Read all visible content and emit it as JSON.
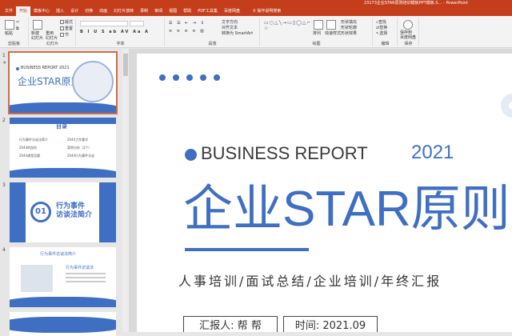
{
  "window": {
    "title": "23173企业STAR原则培训模板PPT模板.S… - PowerPoint"
  },
  "tabs": [
    "文件",
    "开始",
    "模板中心",
    "插入",
    "设计",
    "切换",
    "动画",
    "幻灯片放映",
    "录制",
    "审阅",
    "视图",
    "帮助",
    "PDF工具集",
    "百度网盘"
  ],
  "active_tab": "开始",
  "help_tab": "操作说明搜索",
  "ribbon": {
    "groups": [
      "剪贴板",
      "幻灯片",
      "字体",
      "段落",
      "绘图",
      "编辑",
      "保存"
    ],
    "paste": "粘贴",
    "new_slide": "新建\n幻灯片",
    "reuse_slide": "重用\n幻灯片",
    "layout": "版式",
    "reset": "重置",
    "section": "节",
    "text_direction": "文字方向",
    "align_text": "对齐文本",
    "smartart": "转换为 SmartArt",
    "arrange": "排列",
    "quick_styles": "快速样式",
    "shape_fill": "形状填充",
    "shape_outline": "形状轮廓",
    "shape_effects": "形状效果",
    "find": "查找",
    "replace": "替换",
    "select": "选择",
    "save_baidu": "保存到\n百度网盘"
  },
  "thumbnails": [
    {
      "num": "1",
      "biz": "BUSINESS REPORT 2021",
      "title": "企业STAR原则"
    },
    {
      "num": "2",
      "title": "目录",
      "items": [
        "行为事件访谈法简介",
        "2044的剖析",
        "2044课堂及题",
        "2044工作重学",
        "案例分析（2个）",
        "2044行为事件访谈"
      ]
    },
    {
      "num": "3",
      "badge": "01",
      "title": "行为事件\n访谈法简介"
    },
    {
      "num": "4",
      "heading": "行为事件访谈法简介",
      "sub": "行为事件访谈法"
    }
  ],
  "slide": {
    "biz": "BUSINESS REPORT",
    "year": "2021",
    "title": "企业STAR原则",
    "subtitle": "人事培训/面试总结/企业培训/年终汇报",
    "reporter": "汇报人: 帮 帮",
    "time": "时间: 2021.09"
  },
  "colors": {
    "brand": "#c43e1c",
    "accent": "#3f6fc3"
  }
}
